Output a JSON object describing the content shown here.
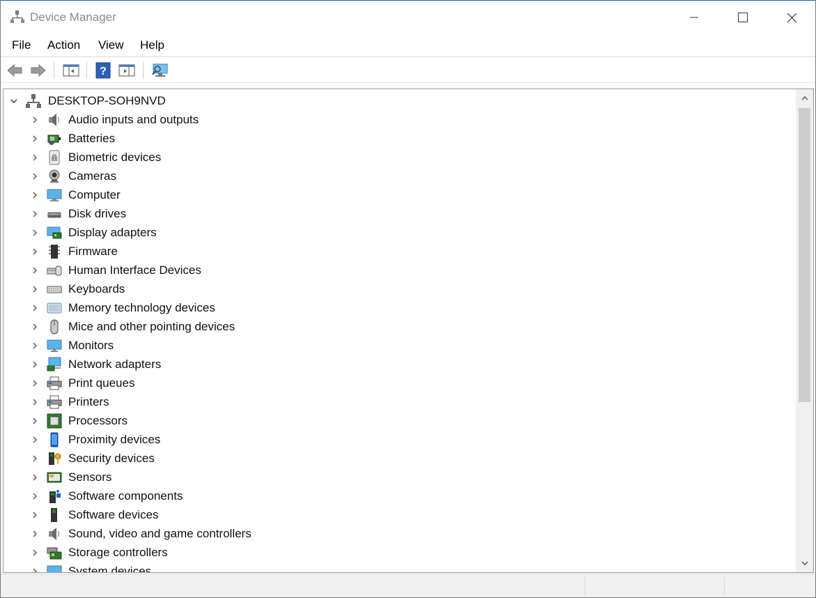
{
  "window": {
    "title": "Device Manager"
  },
  "menu": [
    {
      "id": "file",
      "label": "File"
    },
    {
      "id": "action",
      "label": "Action"
    },
    {
      "id": "view",
      "label": "View"
    },
    {
      "id": "help",
      "label": "Help"
    }
  ],
  "toolbar": {
    "buttons": [
      "back-arrow-icon",
      "forward-arrow-icon",
      "show-hide-console-tree-icon",
      "help-icon",
      "properties-pane-icon",
      "scan-hardware-changes-icon"
    ]
  },
  "tree": {
    "root": {
      "label": "DESKTOP-SOH9NVD",
      "expanded": true,
      "icon": "computer-root-icon"
    },
    "items": [
      {
        "label": "Audio inputs and outputs",
        "icon": "speaker-icon"
      },
      {
        "label": "Batteries",
        "icon": "battery-icon"
      },
      {
        "label": "Biometric devices",
        "icon": "fingerprint-icon"
      },
      {
        "label": "Cameras",
        "icon": "webcam-icon"
      },
      {
        "label": "Computer",
        "icon": "computer-monitor-icon"
      },
      {
        "label": "Disk drives",
        "icon": "disk-drive-icon"
      },
      {
        "label": "Display adapters",
        "icon": "display-adapter-icon"
      },
      {
        "label": "Firmware",
        "icon": "firmware-chip-icon"
      },
      {
        "label": "Human Interface Devices",
        "icon": "hid-icon"
      },
      {
        "label": "Keyboards",
        "icon": "keyboard-icon"
      },
      {
        "label": "Memory technology devices",
        "icon": "memory-card-icon"
      },
      {
        "label": "Mice and other pointing devices",
        "icon": "mouse-icon"
      },
      {
        "label": "Monitors",
        "icon": "monitor-icon"
      },
      {
        "label": "Network adapters",
        "icon": "network-adapter-icon"
      },
      {
        "label": "Print queues",
        "icon": "print-queue-icon"
      },
      {
        "label": "Printers",
        "icon": "printer-icon"
      },
      {
        "label": "Processors",
        "icon": "processor-icon"
      },
      {
        "label": "Proximity devices",
        "icon": "proximity-device-icon"
      },
      {
        "label": "Security devices",
        "icon": "security-key-icon"
      },
      {
        "label": "Sensors",
        "icon": "sensor-icon"
      },
      {
        "label": "Software components",
        "icon": "software-component-icon"
      },
      {
        "label": "Software devices",
        "icon": "software-device-icon"
      },
      {
        "label": "Sound, video and game controllers",
        "icon": "sound-controller-icon"
      },
      {
        "label": "Storage controllers",
        "icon": "storage-controller-icon"
      },
      {
        "label": "System devices",
        "icon": "system-devices-icon"
      }
    ]
  },
  "colors": {
    "accent": "#2b579a",
    "scrollbar_thumb": "#cdcdcd",
    "statusbar": "#f0f0f0"
  }
}
